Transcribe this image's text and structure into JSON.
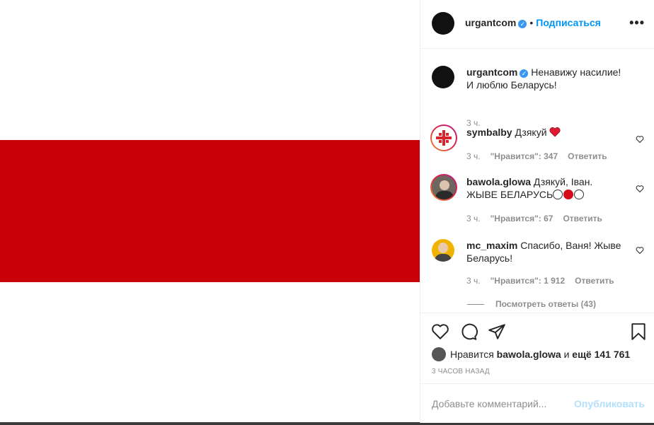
{
  "colors": {
    "flag_red": "#c8010a",
    "link_blue": "#0095f6"
  },
  "post": {
    "author": "urgantcom",
    "verified_icon": "verified-badge-icon",
    "follow_label": "Подписаться",
    "separator": "•",
    "more_label": "•••",
    "caption": "Ненавижу насилие!И люблю Беларусь!",
    "caption_time": "3 ч."
  },
  "comments": [
    {
      "user": "symbalby",
      "text": "Дзякуй",
      "emoji": "red-heart-icon",
      "time": "3 ч.",
      "likes": "\"Нравится\": 347",
      "reply": "Ответить"
    },
    {
      "user": "bawola.glowa",
      "text": "Дзякуй, Іван. ЖЫВЕ БЕЛАРУСЬ",
      "emoji": "white-red-white-circles",
      "time": "3 ч.",
      "likes": "\"Нравится\": 67",
      "reply": "Ответить"
    },
    {
      "user": "mc_maxim",
      "text": "Спасибо, Ваня! Жыве Беларусь!",
      "time": "3 ч.",
      "likes": "\"Нравится\": 1 912",
      "reply": "Ответить"
    }
  ],
  "view_replies": "Посмотреть ответы (43)",
  "likes_summary": {
    "prefix": "Нравится",
    "user": "bawola.glowa",
    "middle": "и",
    "rest": "ещё 141 761"
  },
  "time_ago": "3 часов назад",
  "add_comment": {
    "placeholder": "Добавьте комментарий...",
    "publish": "Опубликовать"
  }
}
